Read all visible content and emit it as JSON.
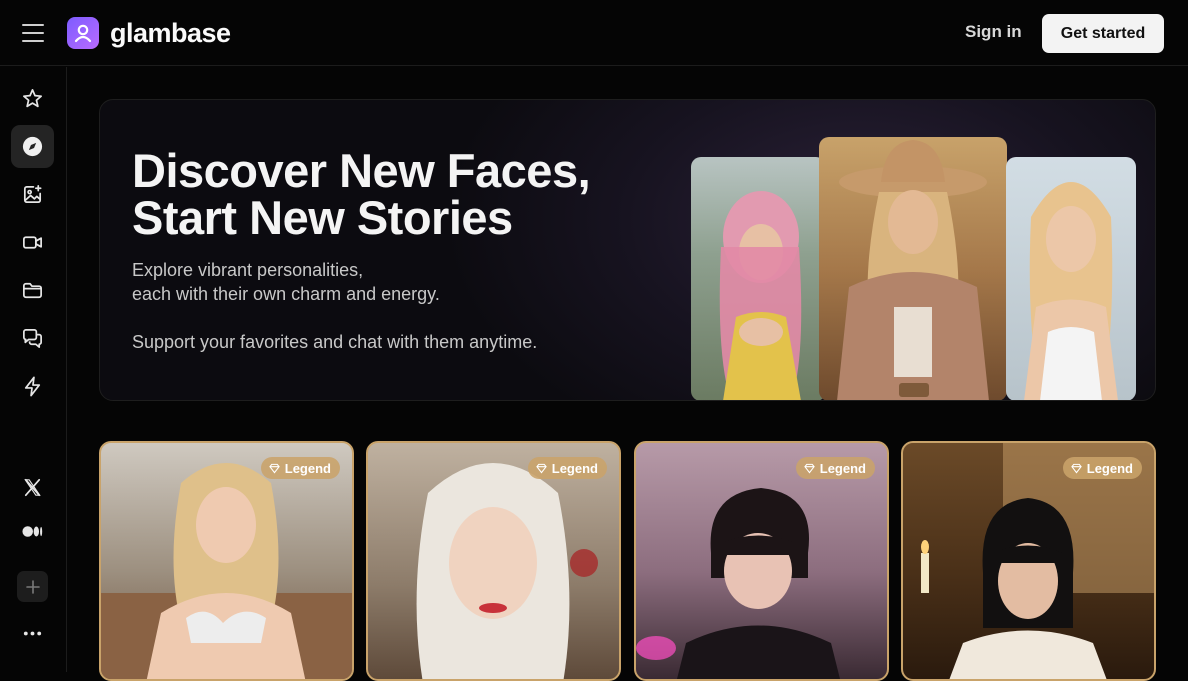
{
  "header": {
    "brand": "glambase",
    "sign_in": "Sign in",
    "get_started": "Get started"
  },
  "sidebar": {
    "items": [
      {
        "icon": "star-icon"
      },
      {
        "icon": "compass-icon",
        "active": true
      },
      {
        "icon": "image-add-icon"
      },
      {
        "icon": "video-icon"
      },
      {
        "icon": "folder-icon"
      },
      {
        "icon": "chat-icon"
      },
      {
        "icon": "lightning-icon"
      }
    ],
    "social": [
      {
        "icon": "x-twitter-icon"
      },
      {
        "icon": "medium-icon"
      }
    ],
    "add_icon": "plus-icon",
    "more_icon": "more-dots-icon"
  },
  "hero": {
    "title_line1": "Discover New Faces,",
    "title_line2": "Start New Stories",
    "subtitle_line1": "Explore vibrant personalities,",
    "subtitle_line2": "each with their own charm and energy.",
    "subtitle_line3": "Support your favorites and chat with them anytime."
  },
  "cards": [
    {
      "badge": "Legend"
    },
    {
      "badge": "Legend"
    },
    {
      "badge": "Legend"
    },
    {
      "badge": "Legend"
    }
  ],
  "colors": {
    "accent": "#8a5cff",
    "legend_gold": "#c9a36a",
    "background": "#050505"
  }
}
